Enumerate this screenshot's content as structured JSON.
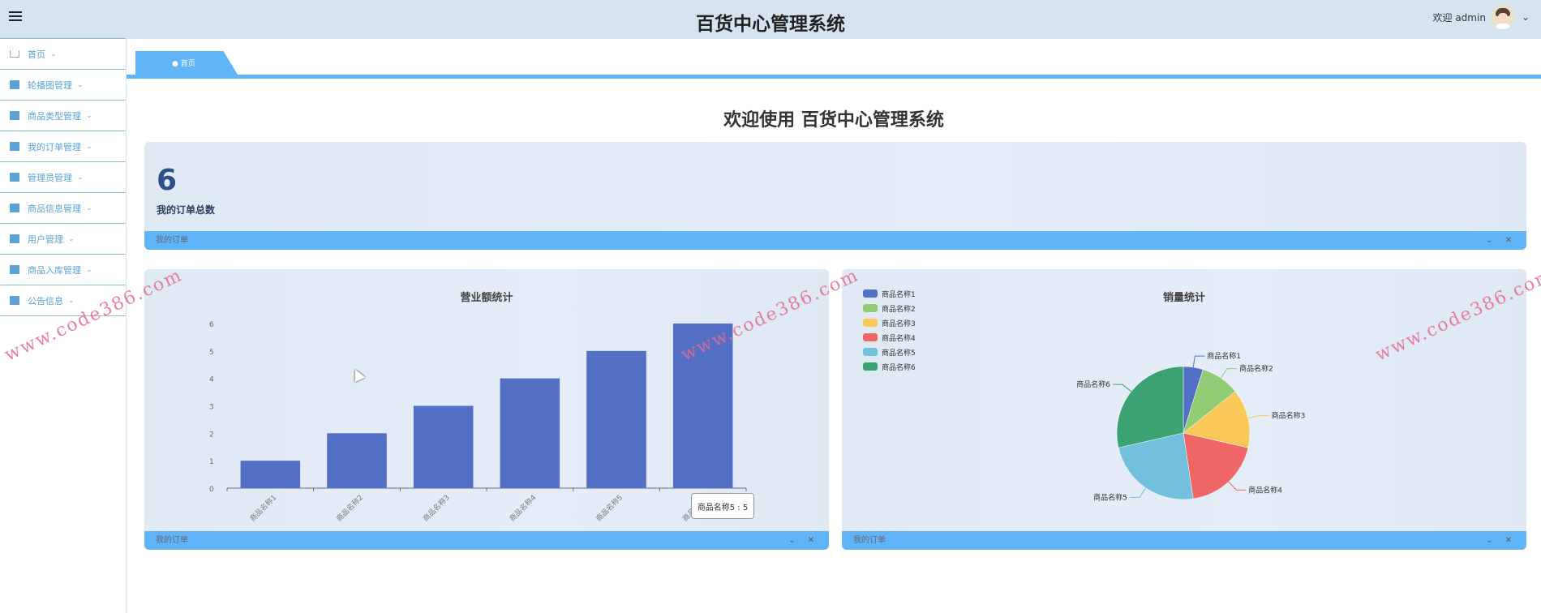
{
  "header": {
    "title": "百货中心管理系统",
    "welcome_text": "欢迎 admin",
    "menu_icon": "menu-fold-icon",
    "avatar_icon": "avatar"
  },
  "sidebar": {
    "items": [
      {
        "label": "首页",
        "icon": "home-icon"
      },
      {
        "label": "轮播图管理",
        "icon": "layout-icon"
      },
      {
        "label": "商品类型管理",
        "icon": "shop-icon"
      },
      {
        "label": "我的订单管理",
        "icon": "gift-icon"
      },
      {
        "label": "管理员管理",
        "icon": "ticket-icon"
      },
      {
        "label": "商品信息管理",
        "icon": "briefcase-icon"
      },
      {
        "label": "用户管理",
        "icon": "award-icon"
      },
      {
        "label": "商品入库管理",
        "icon": "building-icon"
      },
      {
        "label": "公告信息",
        "icon": "book-icon"
      }
    ]
  },
  "tabs": [
    {
      "label": "● 首页",
      "active": true
    }
  ],
  "main": {
    "welcome": "欢迎使用 百货中心管理系统",
    "stat_card": {
      "value": "6",
      "label": "我的订单总数",
      "footer": "我的订单"
    },
    "bar_card": {
      "footer": "我的订单"
    },
    "pie_card": {
      "footer": "我的订单"
    },
    "card_controls": "⌄ ✕",
    "tooltip": "商品名称5 : 5"
  },
  "watermark": "www.code386.com",
  "colors": {
    "accent": "#60b4f8",
    "header_bg": "#d6e4f2",
    "bar": "#5470c6"
  },
  "chart_data": [
    {
      "type": "bar",
      "title": "营业额统计",
      "categories": [
        "商品名称1",
        "商品名称2",
        "商品名称3",
        "商品名称4",
        "商品名称5",
        "商品名称6"
      ],
      "values": [
        1,
        2,
        3,
        4,
        5,
        6
      ],
      "ylim": [
        0,
        6
      ],
      "yticks": [
        "0",
        "1",
        "2",
        "3",
        "4",
        "5",
        "6"
      ],
      "grid": false
    },
    {
      "type": "pie",
      "title": "销量统计",
      "categories": [
        "商品名称1",
        "商品名称2",
        "商品名称3",
        "商品名称4",
        "商品名称5",
        "商品名称6"
      ],
      "values": [
        1,
        2,
        3,
        4,
        5,
        6
      ],
      "colors": [
        "#5470c6",
        "#91cc75",
        "#fac858",
        "#ee6666",
        "#73c0de",
        "#3ba272"
      ],
      "legend": "top-left"
    }
  ]
}
